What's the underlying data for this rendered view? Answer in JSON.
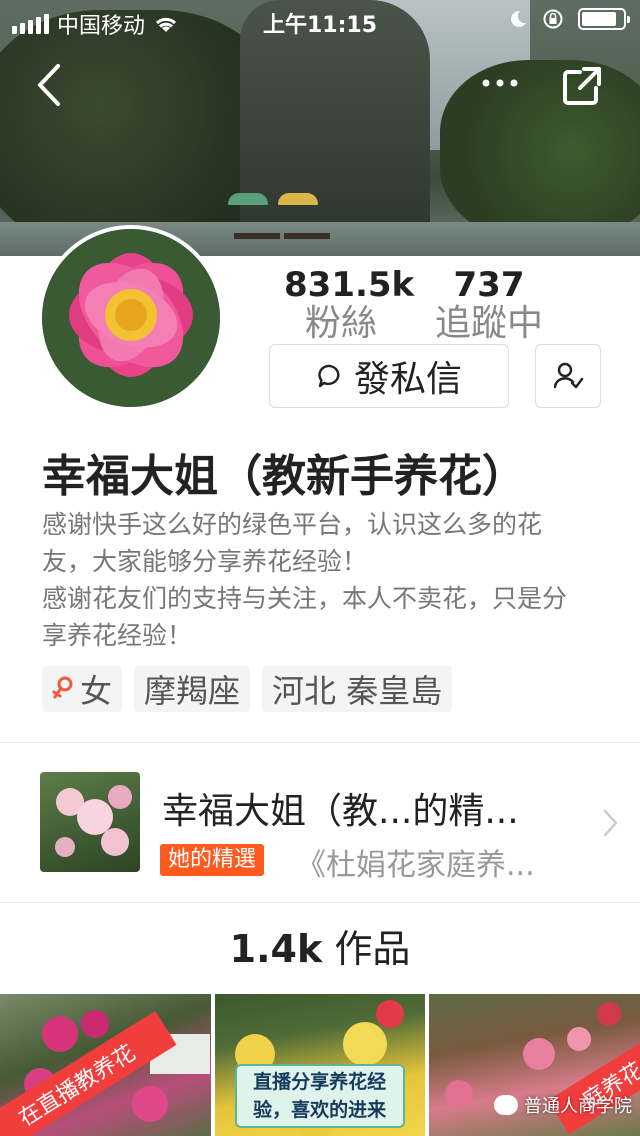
{
  "status_bar": {
    "carrier": "中国移动",
    "time": "上午11:15",
    "battery_level": 0.85
  },
  "profile": {
    "followers_count": "831.5k",
    "followers_label": "粉絲",
    "following_count": "737",
    "following_label": "追蹤中",
    "message_button": "發私信",
    "name": "幸福大姐（教新手养花）",
    "bio_lines": [
      "感谢快手这么好的绿色平台，认识这么多的花",
      "友，大家能够分享养花经验！",
      "感谢花友们的支持与关注，本人不卖花，只是分",
      "享养花经验！"
    ],
    "tags": {
      "gender": "女",
      "zodiac": "摩羯座",
      "location": "河北 秦皇島"
    }
  },
  "collection": {
    "title": "幸福大姐（教...的精...",
    "badge": "她的精選",
    "subtitle": "《杜娟花家庭养..."
  },
  "works": {
    "count": "1.4k",
    "label": "作品"
  },
  "grid": {
    "item1_ribbon": "在直播教养花",
    "item2_caption_line1": "直播分享养花经",
    "item2_caption_line2": "验，喜欢的进来",
    "item3_ribbon": "庭养花"
  },
  "watermark": "普通人商学院",
  "colors": {
    "accent_orange": "#ff5a1f",
    "female_symbol": "#f25a3b",
    "ribbon_red": "#f23d3d"
  },
  "icons": [
    "back-chevron-icon",
    "more-dots-icon",
    "share-icon",
    "chat-bubble-icon",
    "add-friend-icon",
    "chevron-right-icon",
    "female-icon",
    "wechat-icon"
  ]
}
